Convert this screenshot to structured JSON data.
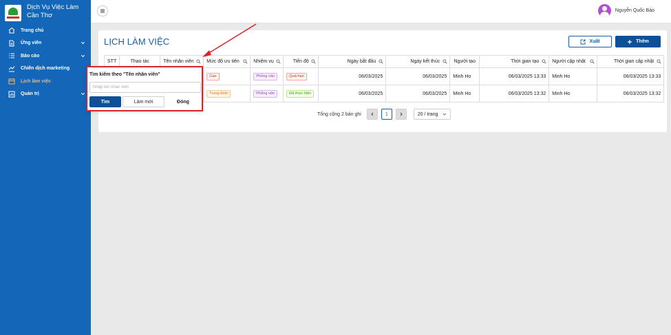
{
  "brand": {
    "title": "Dịch Vụ Việc Làm Cần Thơ"
  },
  "sidebar": {
    "items": [
      {
        "label": "Trang chủ",
        "icon": "home-icon",
        "has_children": false,
        "active": false
      },
      {
        "label": "Ứng viên",
        "icon": "file-icon",
        "has_children": true,
        "active": false
      },
      {
        "label": "Báo cáo",
        "icon": "list-icon",
        "has_children": true,
        "active": false
      },
      {
        "label": "Chiến dịch marketing",
        "icon": "chart-icon",
        "has_children": false,
        "active": false
      },
      {
        "label": "Lịch làm việc",
        "icon": "calendar-icon",
        "has_children": false,
        "active": true
      },
      {
        "label": "Quản trị",
        "icon": "admin-icon",
        "has_children": true,
        "active": false
      }
    ]
  },
  "header": {
    "user_name": "Nguyễn Quốc Bảo"
  },
  "page": {
    "title": "LỊCH LÀM VIỆC",
    "export_label": "Xuất",
    "add_label": "Thêm"
  },
  "table": {
    "columns": [
      "STT",
      "Thao tác",
      "Tên nhân viên",
      "Mức độ ưu tiên",
      "Nhiệm vụ",
      "Tiến độ",
      "Ngày bắt đầu",
      "Ngày kết thúc",
      "Người tạo",
      "Thời gian tạo",
      "Người cập nhật",
      "Thời gian cập nhật"
    ],
    "rows": [
      {
        "priority": "Cao",
        "task": "Phỏng vấn",
        "progress": "Quá hạn",
        "start": "06/03/2025",
        "end": "06/03/2025",
        "creator": "Minh Ho",
        "created_at": "06/03/2025 13:33",
        "updater": "Minh Ho",
        "updated_at": "06/03/2025 13:33"
      },
      {
        "priority": "Trung bình",
        "task": "Phỏng vấn",
        "progress": "Đã thực hiện",
        "start": "06/03/2025",
        "end": "06/03/2025",
        "creator": "Minh Ho",
        "created_at": "06/03/2025 13:32",
        "updater": "Minh Ho",
        "updated_at": "06/03/2025 13:32"
      }
    ]
  },
  "pagination": {
    "total_text": "Tổng cộng 2 bản ghi",
    "current_page": "1",
    "page_size": "20 / trang"
  },
  "search_popup": {
    "title": "Tìm kiếm theo \"Tên nhân viên\"",
    "placeholder": "Nhập tên nhân viên",
    "search_label": "Tìm",
    "reset_label": "Làm mới",
    "close_label": "Đóng"
  },
  "colors": {
    "sidebar_bg": "#1466b8",
    "primary": "#0f4f96",
    "active_menu": "#f3b46a",
    "annotation_red": "#d9252a"
  }
}
